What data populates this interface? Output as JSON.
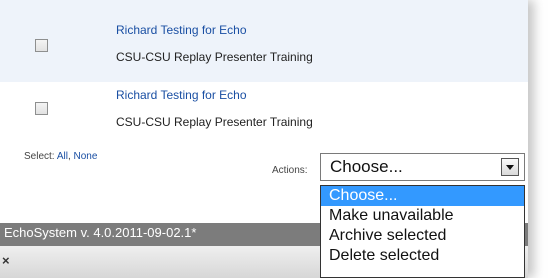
{
  "recordings": [
    {
      "title": "Richard Testing for Echo",
      "subtitle": "CSU-CSU Replay Presenter Training"
    },
    {
      "title": "Richard Testing for Echo",
      "subtitle": "CSU-CSU Replay Presenter Training"
    }
  ],
  "selection": {
    "label": "Select:",
    "all_label": "All",
    "none_label": "None"
  },
  "actions": {
    "label": "Actions:",
    "selected_value": "Choose...",
    "options": [
      "Choose...",
      "Make unavailable",
      "Archive selected",
      "Delete selected"
    ],
    "highlight_color": "#3399ff"
  },
  "footer": {
    "version": "EchoSystem v. 4.0.2011-09-02.1*",
    "close_symbol": "×"
  }
}
